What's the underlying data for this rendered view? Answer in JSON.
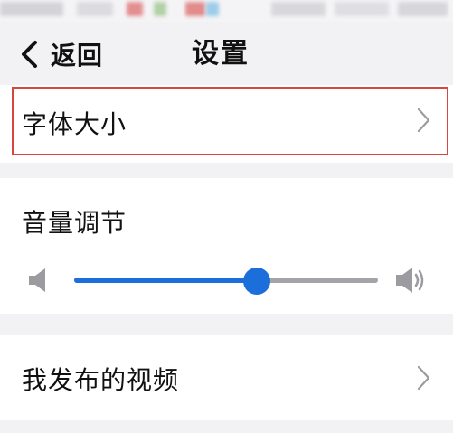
{
  "nav": {
    "back_label": "返回",
    "title": "设置"
  },
  "settings": {
    "font_size": {
      "label": "字体大小"
    },
    "volume": {
      "label": "音量调节",
      "level_percent": 60
    },
    "my_videos": {
      "label": "我发布的视频"
    }
  },
  "colors": {
    "accent": "#1c6fdb",
    "highlight": "#d9463f",
    "background": "#f2f2f4"
  }
}
